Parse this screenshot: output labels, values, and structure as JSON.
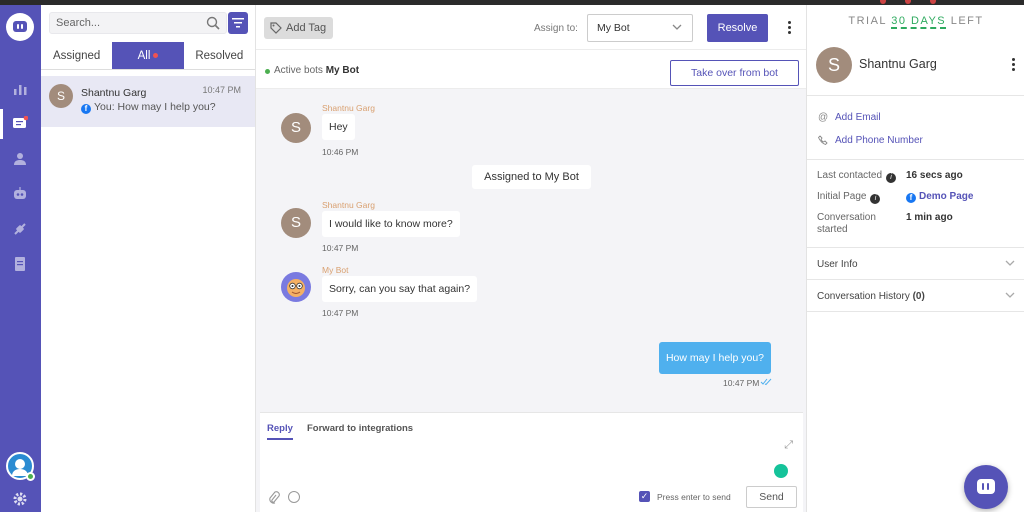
{
  "list": {
    "search_placeholder": "Search...",
    "tabs": [
      "Assigned",
      "All",
      "Resolved"
    ],
    "conversation": {
      "initial": "S",
      "name": "Shantnu Garg",
      "time": "10:47 PM",
      "preview": "You: How may I help you?"
    }
  },
  "chat": {
    "add_tag": "Add Tag",
    "assign_label": "Assign to:",
    "assign_value": "My Bot",
    "resolve": "Resolve",
    "active_bots_label": "Active bots",
    "active_bot_name": "My Bot",
    "takeover": "Take over from bot",
    "messages": [
      {
        "sender": "Shantnu Garg",
        "initial": "S",
        "text": "Hey",
        "time": "10:46 PM"
      },
      {
        "system": "Assigned to My Bot"
      },
      {
        "sender": "Shantnu Garg",
        "initial": "S",
        "text": "I would like to know more?",
        "time": "10:47 PM"
      },
      {
        "sender": "My Bot",
        "text": "Sorry, can you say that again?",
        "time": "10:47 PM"
      },
      {
        "outgoing": true,
        "text": "How may I help you?",
        "time": "10:47 PM"
      }
    ],
    "reply_tabs": [
      "Reply",
      "Forward to integrations"
    ],
    "press_enter": "Press enter to send",
    "send": "Send"
  },
  "profile": {
    "trial_prefix": "TRIAL",
    "trial_days": "30 DAYS",
    "trial_suffix": "LEFT",
    "initial": "S",
    "name": "Shantnu Garg",
    "add_email": "Add Email",
    "add_phone": "Add Phone Number",
    "last_contacted_label": "Last contacted",
    "last_contacted_value": "16 secs ago",
    "initial_page_label": "Initial Page",
    "initial_page_value": "Demo Page",
    "conversation_started_label": "Conversation started",
    "conversation_started_value": "1 min ago",
    "user_info": "User Info",
    "conversation_history": "Conversation History",
    "conversation_history_count": "(0)"
  },
  "colors": {
    "primary": "#5553b7",
    "outgoing": "#4fb0ee",
    "online": "#4caf50",
    "trial": "#2eaa5f"
  }
}
